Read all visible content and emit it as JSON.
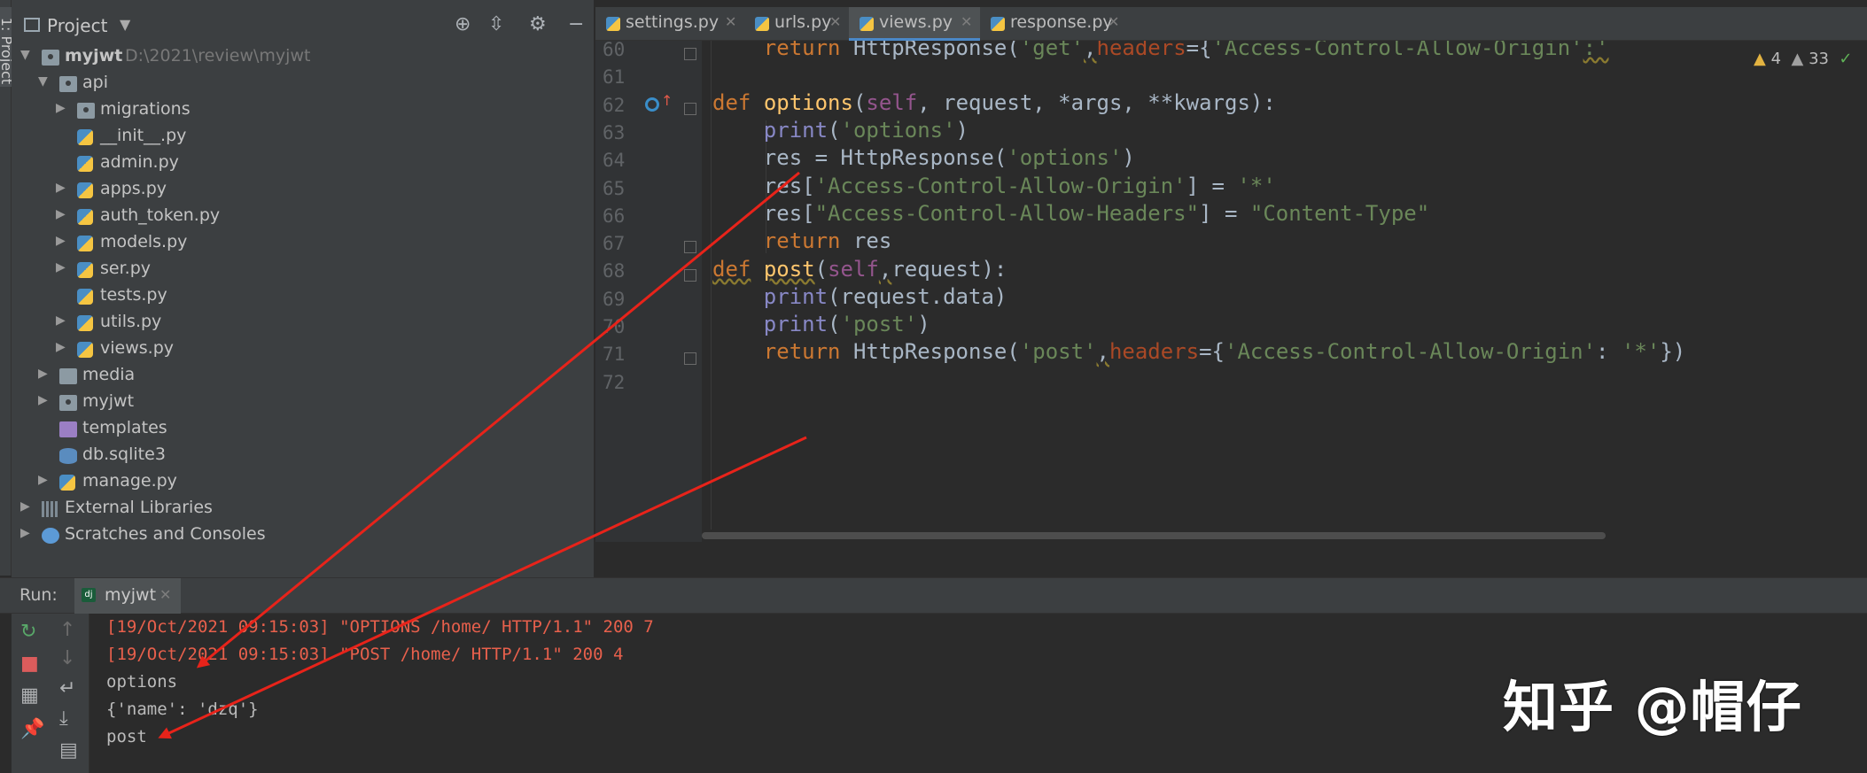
{
  "project_panel": {
    "title": "Project",
    "tree": [
      {
        "label": "myjwt",
        "path": "D:\\2021\\review\\myjwt",
        "type": "folder-pkg",
        "depth": 0,
        "expanded": true,
        "bold": true
      },
      {
        "label": "api",
        "type": "folder-pkg",
        "depth": 1,
        "expanded": true
      },
      {
        "label": "migrations",
        "type": "folder-pkg",
        "depth": 2,
        "expanded": false
      },
      {
        "label": "__init__.py",
        "type": "py",
        "depth": 2
      },
      {
        "label": "admin.py",
        "type": "py",
        "depth": 2
      },
      {
        "label": "apps.py",
        "type": "py",
        "depth": 2,
        "expanded": false
      },
      {
        "label": "auth_token.py",
        "type": "py",
        "depth": 2,
        "expanded": false
      },
      {
        "label": "models.py",
        "type": "py",
        "depth": 2,
        "expanded": false
      },
      {
        "label": "ser.py",
        "type": "py",
        "depth": 2,
        "expanded": false
      },
      {
        "label": "tests.py",
        "type": "py",
        "depth": 2
      },
      {
        "label": "utils.py",
        "type": "py",
        "depth": 2,
        "expanded": false
      },
      {
        "label": "views.py",
        "type": "py",
        "depth": 2,
        "expanded": false
      },
      {
        "label": "media",
        "type": "folder",
        "depth": 1,
        "expanded": false
      },
      {
        "label": "myjwt",
        "type": "folder-pkg",
        "depth": 1,
        "expanded": false
      },
      {
        "label": "templates",
        "type": "folder-purple",
        "depth": 1
      },
      {
        "label": "db.sqlite3",
        "type": "db",
        "depth": 1
      },
      {
        "label": "manage.py",
        "type": "py",
        "depth": 1,
        "expanded": false
      },
      {
        "label": "External Libraries",
        "type": "lib",
        "depth": 0,
        "expanded": false
      },
      {
        "label": "Scratches and Consoles",
        "type": "scratch",
        "depth": 0,
        "expanded": false
      }
    ]
  },
  "side_tab": {
    "label": "1: Project"
  },
  "editor_tabs": [
    {
      "label": "settings.py",
      "active": false
    },
    {
      "label": "urls.py",
      "active": false
    },
    {
      "label": "views.py",
      "active": true
    },
    {
      "label": "response.py",
      "active": false
    }
  ],
  "inspections": {
    "warnings": "4",
    "weak_warnings": "33"
  },
  "code_lines": [
    {
      "num": "60"
    },
    {
      "num": "61"
    },
    {
      "num": "62"
    },
    {
      "num": "63"
    },
    {
      "num": "64"
    },
    {
      "num": "65"
    },
    {
      "num": "66"
    },
    {
      "num": "67"
    },
    {
      "num": "68"
    },
    {
      "num": "69"
    },
    {
      "num": "70"
    },
    {
      "num": "71"
    },
    {
      "num": "72"
    }
  ],
  "code": {
    "l60": {
      "kw": "return",
      "cls": "HttpResponse",
      "s1": "'get'",
      "kwarg": "headers",
      "s2": "'Access-Control-Allow-Origin'",
      "tail": ":'"
    },
    "l62": {
      "kw": "def",
      "fn": "options",
      "self": "self",
      "rest": ", request, *args, **kwargs):"
    },
    "l63": {
      "bi": "print",
      "st": "'options'"
    },
    "l64": {
      "pre": "res = HttpResponse(",
      "st": "'options'",
      "post": ")"
    },
    "l65": {
      "pre": "res[",
      "st": "'Access-Control-Allow-Origin'",
      "mid": "] = ",
      "st2": "'*'"
    },
    "l66": {
      "pre": "res[",
      "st": "\"Access-Control-Allow-Headers\"",
      "mid": "] = ",
      "st2": "\"Content-Type\""
    },
    "l67": {
      "kw": "return",
      "rest": " res"
    },
    "l68": {
      "kw": "def",
      "fn": "post",
      "self": "self",
      "rest": "request):"
    },
    "l69": {
      "bi": "print",
      "rest": "(request.data)"
    },
    "l70": {
      "bi": "print",
      "st": "'post'"
    },
    "l71": {
      "kw": "return",
      "cls": "HttpResponse",
      "s1": "'post'",
      "kwarg": "headers",
      "s2": "'Access-Control-Allow-Origin'",
      "s3": "'*'"
    }
  },
  "run_panel": {
    "label": "Run:",
    "tab": "myjwt",
    "output": [
      {
        "text": "[19/Oct/2021 09:15:03] \"OPTIONS /home/ HTTP/1.1\" 200 7",
        "kind": "err"
      },
      {
        "text": "[19/Oct/2021 09:15:03] \"POST /home/ HTTP/1.1\" 200 4",
        "kind": "err"
      },
      {
        "text": "options",
        "kind": "std"
      },
      {
        "text": "{'name': 'dzq'}",
        "kind": "std"
      },
      {
        "text": "post",
        "kind": "std"
      }
    ]
  },
  "watermark": {
    "text": "知乎 @帽仔"
  },
  "colors": {
    "arrow": "#e8231a",
    "accent": "#4a88c7",
    "keyword": "#cc7832",
    "string": "#6a8759",
    "function": "#ffc66d"
  }
}
